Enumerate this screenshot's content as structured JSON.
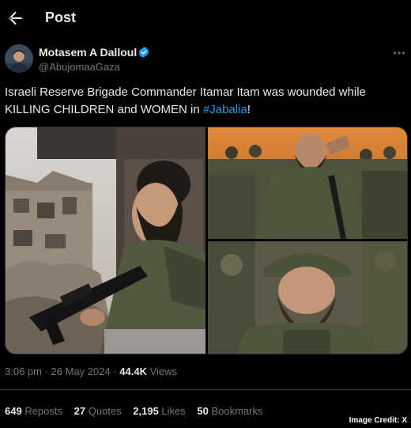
{
  "header": {
    "title": "Post",
    "back_icon": "arrow-left-icon"
  },
  "author": {
    "name": "Motasem A Dalloul",
    "handle": "@AbujomaaGaza",
    "verified_icon": "verified-badge-icon",
    "verified_color": "#1d9bf0"
  },
  "tweet": {
    "text_before": "Israeli Reserve Brigade Commander Itamar Itam was wounded while KILLING CHILDREN and WOMEN in ",
    "hashtag": "#Jabalia",
    "text_after": "!"
  },
  "meta": {
    "time": "3:06 pm",
    "separator": " · ",
    "date": "26 May 2024",
    "separator2": " · ",
    "views_count": "44.4K",
    "views_label": " Views"
  },
  "stats": {
    "reposts": {
      "count": "649",
      "label": " Reposts"
    },
    "quotes": {
      "count": "27",
      "label": " Quotes"
    },
    "likes": {
      "count": "2,195",
      "label": " Likes"
    },
    "bookmarks": {
      "count": "50",
      "label": " Bookmarks"
    }
  },
  "credit": "Image Credit: X",
  "colors": {
    "background": "#000000",
    "text": "#e7e9ea",
    "muted": "#71767b",
    "link": "#1d9bf0",
    "border": "#2f3336"
  }
}
